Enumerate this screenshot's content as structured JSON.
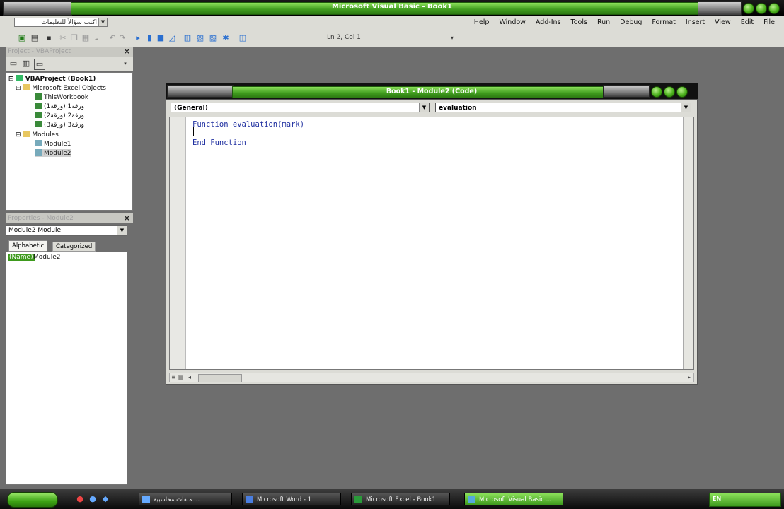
{
  "window": {
    "title": "Microsoft Visual Basic - Book1"
  },
  "menu": {
    "ask_placeholder": "اكتب سؤالاً للتعليمات",
    "items": [
      "Help",
      "Window",
      "Add-Ins",
      "Tools",
      "Run",
      "Debug",
      "Format",
      "Insert",
      "View",
      "Edit",
      "File"
    ]
  },
  "toolbar": {
    "position": "Ln 2, Col 1"
  },
  "project_pane": {
    "title": "Project - VBAProject",
    "root": "VBAProject (Book1)",
    "folder_objects": "Microsoft Excel Objects",
    "objects": [
      "ThisWorkbook",
      "ورقة1 (ورقة1)",
      "ورقة2 (ورقة2)",
      "ورقة3 (ورقة3)"
    ],
    "folder_modules": "Modules",
    "modules": [
      "Module1",
      "Module2"
    ]
  },
  "properties_pane": {
    "title": "Properties - Module2",
    "object": "Module2 Module",
    "tab_alphabetic": "Alphabetic",
    "tab_categorized": "Categorized",
    "prop_name": "(Name)",
    "prop_value": "Module2"
  },
  "code_window": {
    "title": "Book1 - Module2 (Code)",
    "object_combo": "(General)",
    "proc_combo": "evaluation",
    "lines": [
      "Function evaluation(mark)",
      "",
      "End Function"
    ]
  },
  "taskbar": {
    "tasks": [
      "ملفات محاسبية ...",
      "Microsoft Word - 1",
      "Microsoft Excel - Book1",
      "Microsoft Visual Basic ..."
    ],
    "tray_lang": "EN"
  },
  "colors": {
    "accent": "#3e9a1d",
    "background": "#6e6e6e"
  }
}
